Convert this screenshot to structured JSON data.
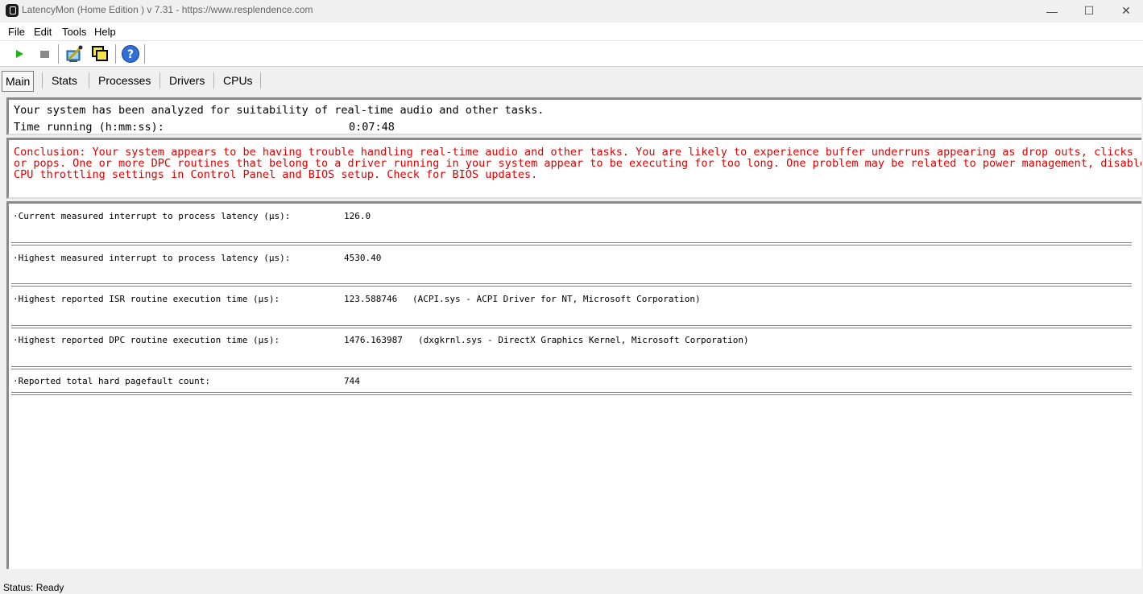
{
  "window": {
    "title": "LatencyMon  (Home Edition )  v 7.31 - https://www.resplendence.com",
    "minimize_glyph": "—",
    "maximize_glyph": "☐",
    "close_glyph": "✕"
  },
  "menu": {
    "file": "File",
    "edit": "Edit",
    "tools": "Tools",
    "help": "Help"
  },
  "toolbar": {
    "icons": [
      "play-icon",
      "stop-icon",
      "analyze-icon",
      "windows-icon",
      "help-icon"
    ]
  },
  "tabs": [
    "Main",
    "Stats",
    "Processes",
    "Drivers",
    "CPUs"
  ],
  "summary": {
    "line1": "Your system has been analyzed for suitability of real-time audio and other tasks.",
    "time_label": "Time running (h:mm:ss):",
    "time_value": "0:07:48"
  },
  "conclusion": {
    "color": "#e00000",
    "line1": "Conclusion: Your system appears to be having trouble handling real-time audio and other tasks. You are likely to experience buffer underruns appearing as drop outs, clicks",
    "line2": "or pops. One or more DPC routines that belong to a driver running in your system appear to be executing for too long. One problem may be related to power management, disable",
    "line3": "CPU throttling settings in Control Panel and BIOS setup. Check for BIOS updates."
  },
  "metrics": [
    {
      "label": "·Current measured interrupt to process latency (µs):",
      "value": "126.0",
      "detail": ""
    },
    {
      "label": "·Highest measured interrupt to process latency (µs):",
      "value": "4530.40",
      "detail": ""
    },
    {
      "label": "·Highest reported ISR routine execution time (µs):",
      "value": "123.588746",
      "detail": "(ACPI.sys - ACPI Driver for NT, Microsoft Corporation)"
    },
    {
      "label": "·Highest reported DPC routine execution time (µs):",
      "value": "1476.163987",
      "detail": "(dxgkrnl.sys - DirectX Graphics Kernel, Microsoft Corporation)"
    },
    {
      "label": "·Reported total hard pagefault count:",
      "value": "744",
      "detail": ""
    }
  ],
  "status": "Status: Ready"
}
